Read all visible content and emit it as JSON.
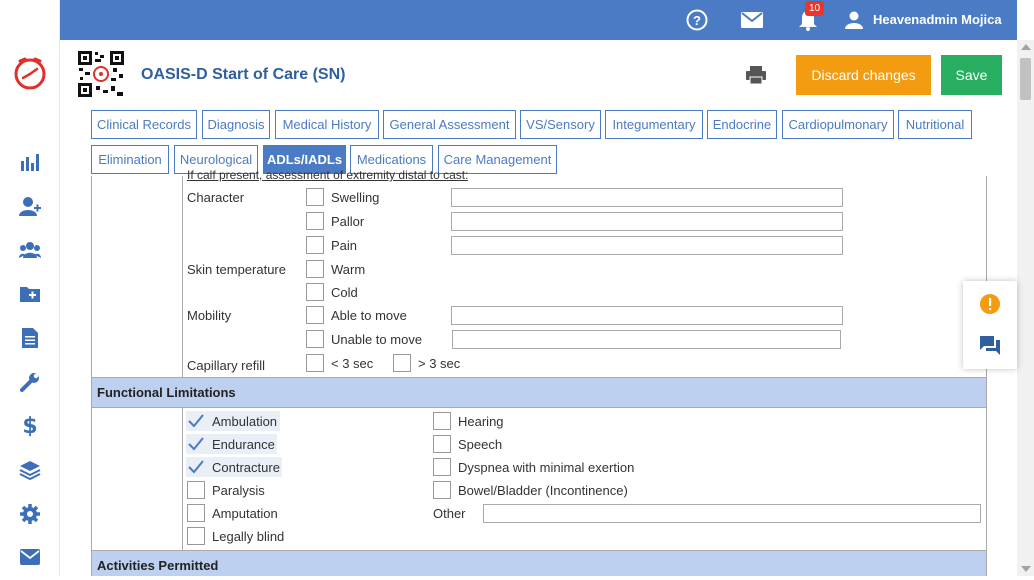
{
  "topbar": {
    "notification_count": "10",
    "user_name": "Heavenadmin Mojica"
  },
  "header": {
    "title": "OASIS-D Start of Care (SN)",
    "discard_label": "Discard changes",
    "save_label": "Save"
  },
  "tabs_row1": [
    "Clinical Records",
    "Diagnosis",
    "Medical History",
    "General Assessment",
    "VS/Sensory",
    "Integumentary",
    "Endocrine",
    "Cardiopulmonary",
    "Nutritional"
  ],
  "tabs_row2": [
    "Elimination",
    "Neurological",
    "ADLs/IADLs",
    "Medications",
    "Care Management"
  ],
  "active_tab": "ADLs/IADLs",
  "extremity": {
    "cutoff_text": "If calf present, assessment of extremity distal to cast:",
    "character_label": "Character",
    "character_options": [
      "Swelling",
      "Pallor",
      "Pain"
    ],
    "skin_temp_label": "Skin temperature",
    "skin_temp_options": [
      "Warm",
      "Cold"
    ],
    "mobility_label": "Mobility",
    "mobility_options": [
      "Able to move",
      "Unable to move"
    ],
    "capillary_label": "Capillary refill",
    "capillary_options": [
      "< 3 sec",
      "> 3 sec"
    ]
  },
  "functional": {
    "heading": "Functional Limitations",
    "left_items": [
      {
        "label": "Ambulation",
        "checked": true
      },
      {
        "label": "Endurance",
        "checked": true
      },
      {
        "label": "Contracture",
        "checked": true
      },
      {
        "label": "Paralysis",
        "checked": false
      },
      {
        "label": "Amputation",
        "checked": false
      },
      {
        "label": "Legally blind",
        "checked": false
      }
    ],
    "right_items": [
      {
        "label": "Hearing",
        "checked": false
      },
      {
        "label": "Speech",
        "checked": false
      },
      {
        "label": "Dyspnea with minimal exertion",
        "checked": false
      },
      {
        "label": "Bowel/Bladder (Incontinence)",
        "checked": false
      }
    ],
    "other_label": "Other",
    "other_value": ""
  },
  "activities": {
    "heading": "Activities Permitted"
  },
  "colors": {
    "primary": "#4a7bc4",
    "discard": "#f39c12",
    "save": "#27ae60",
    "section_bg": "#bdd0ef",
    "badge": "#e8362f"
  }
}
